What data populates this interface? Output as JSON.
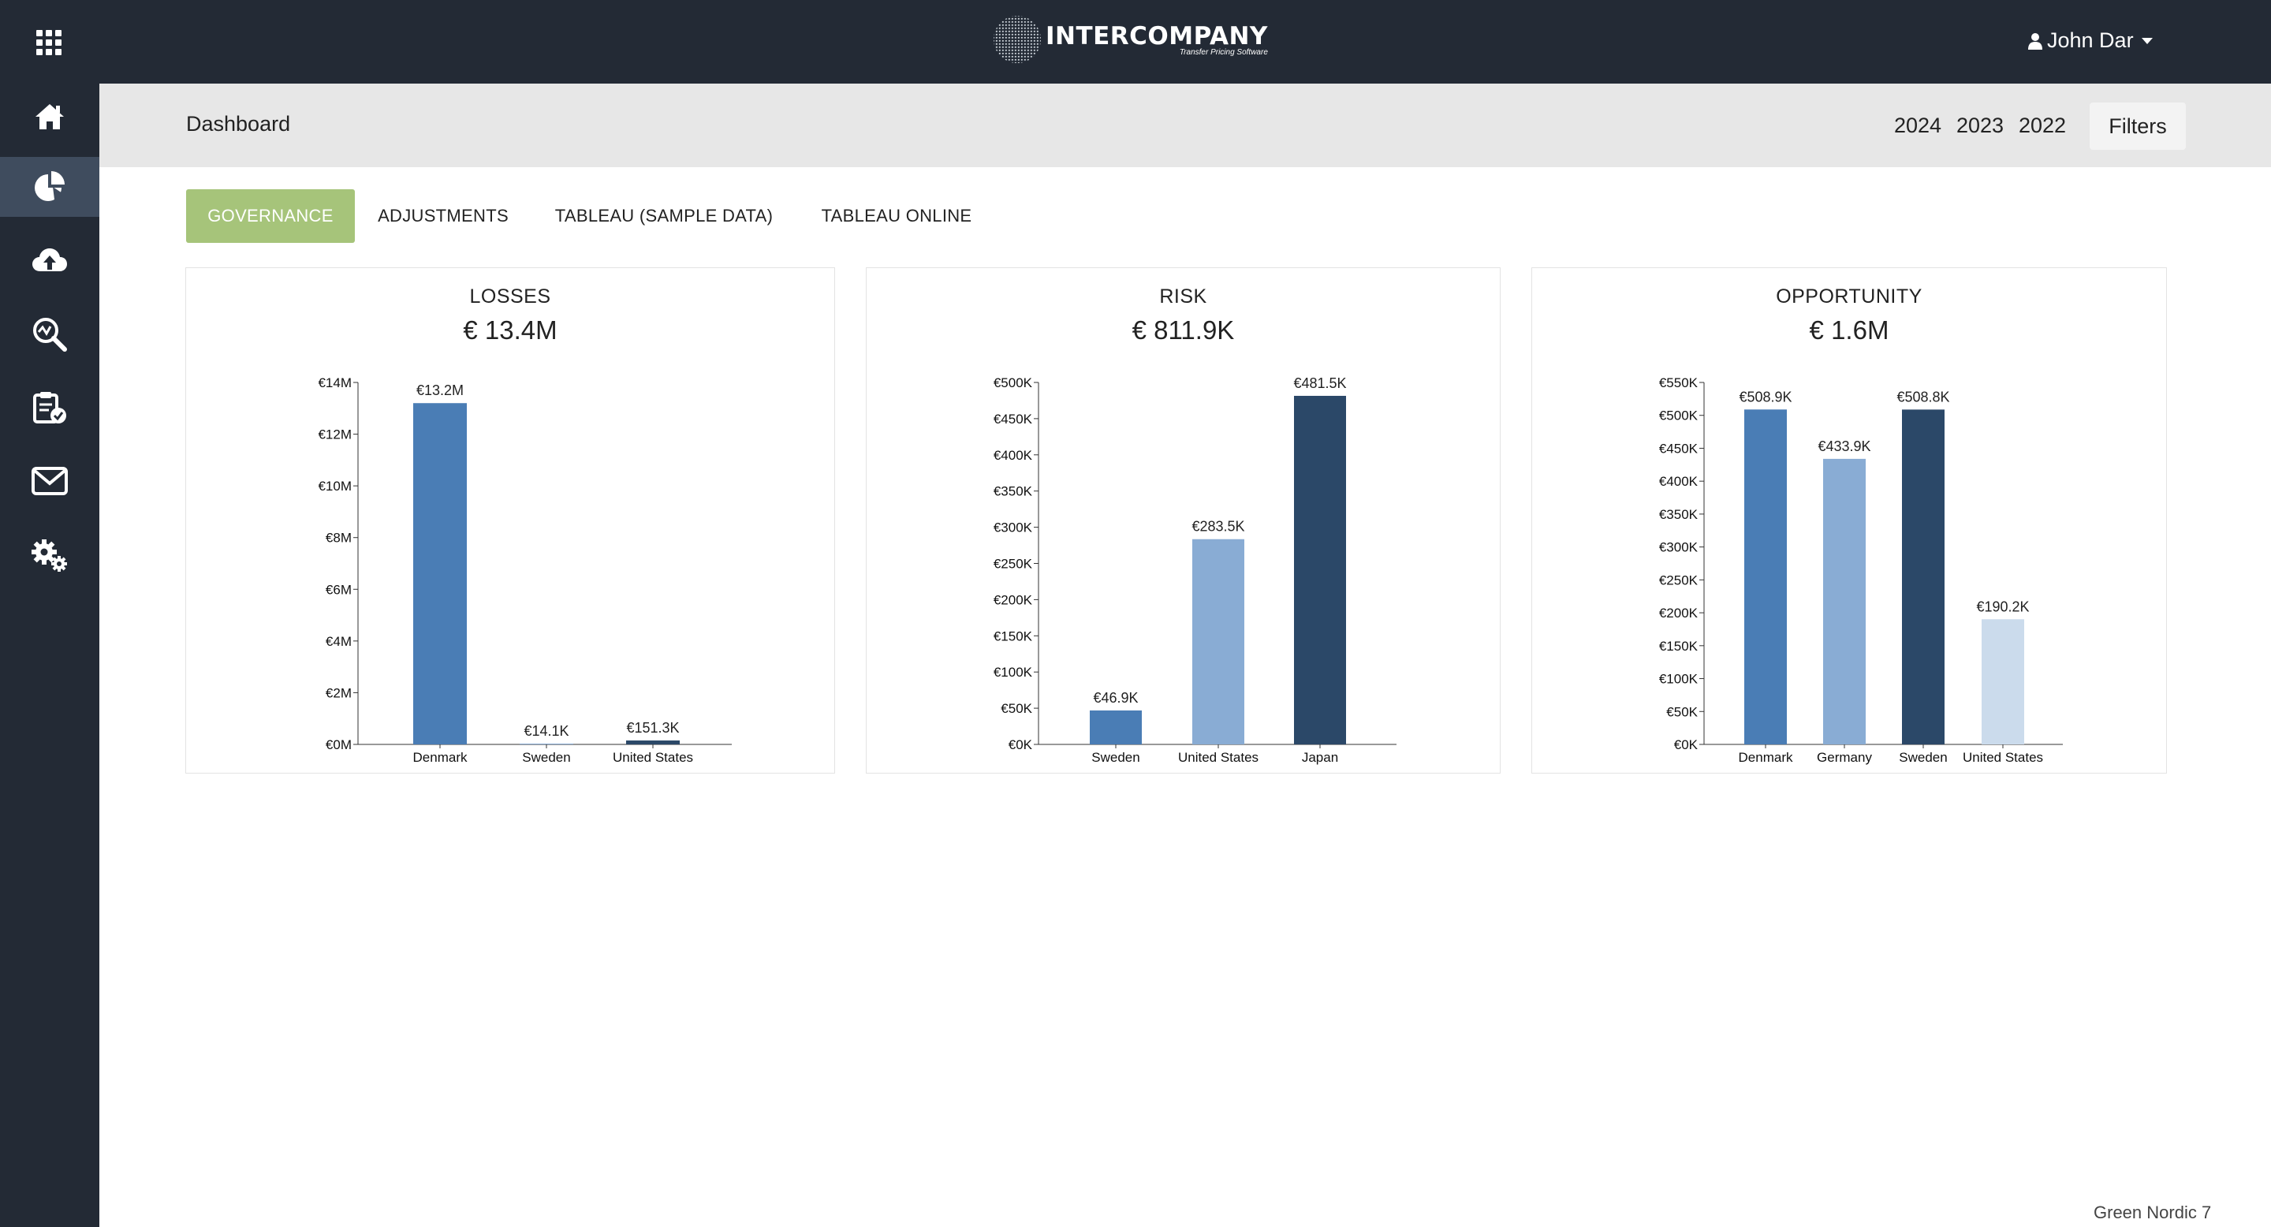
{
  "app": {
    "logo_name": "INTERCOMPANY",
    "logo_tagline": "Transfer Pricing Software"
  },
  "user": {
    "name": "John Dar"
  },
  "sidebar": {
    "items": [
      {
        "icon": "home-icon"
      },
      {
        "icon": "pie-chart-icon",
        "active": true
      },
      {
        "icon": "cloud-upload-icon"
      },
      {
        "icon": "analytics-search-icon"
      },
      {
        "icon": "clipboard-check-icon"
      },
      {
        "icon": "mail-icon"
      },
      {
        "icon": "settings-gears-icon"
      }
    ]
  },
  "header": {
    "title": "Dashboard",
    "years": [
      "2024",
      "2023",
      "2022"
    ],
    "filters_label": "Filters"
  },
  "tabs": [
    {
      "label": "GOVERNANCE",
      "active": true
    },
    {
      "label": "ADJUSTMENTS"
    },
    {
      "label": "TABLEAU (SAMPLE DATA)"
    },
    {
      "label": "TABLEAU ONLINE"
    }
  ],
  "cards": [
    {
      "title": "LOSSES",
      "total": "€ 13.4M"
    },
    {
      "title": "RISK",
      "total": "€ 811.9K"
    },
    {
      "title": "OPPORTUNITY",
      "total": "€ 1.6M"
    }
  ],
  "chart_data": [
    {
      "type": "bar",
      "title": "LOSSES",
      "categories": [
        "Denmark",
        "Sweden",
        "United States"
      ],
      "values": [
        13200000,
        14100,
        151300
      ],
      "value_labels": [
        "€13.2M",
        "€14.1K",
        "€151.3K"
      ],
      "bar_colors": [
        "#4a7db5",
        "#89acd4",
        "#2b4868"
      ],
      "ylim": [
        0,
        14000000
      ],
      "y_ticks": [
        0,
        2000000,
        4000000,
        6000000,
        8000000,
        10000000,
        12000000,
        14000000
      ],
      "y_tick_labels": [
        "€0M",
        "€2M",
        "€4M",
        "€6M",
        "€8M",
        "€10M",
        "€12M",
        "€14M"
      ],
      "grid": false
    },
    {
      "type": "bar",
      "title": "RISK",
      "categories": [
        "Sweden",
        "United States",
        "Japan"
      ],
      "values": [
        46900,
        283500,
        481500
      ],
      "value_labels": [
        "€46.9K",
        "€283.5K",
        "€481.5K"
      ],
      "bar_colors": [
        "#4a7db5",
        "#89acd4",
        "#2b4868"
      ],
      "ylim": [
        0,
        500000
      ],
      "y_ticks": [
        0,
        50000,
        100000,
        150000,
        200000,
        250000,
        300000,
        350000,
        400000,
        450000,
        500000
      ],
      "y_tick_labels": [
        "€0K",
        "€50K",
        "€100K",
        "€150K",
        "€200K",
        "€250K",
        "€300K",
        "€350K",
        "€400K",
        "€450K",
        "€500K"
      ],
      "grid": false
    },
    {
      "type": "bar",
      "title": "OPPORTUNITY",
      "categories": [
        "Denmark",
        "Germany",
        "Sweden",
        "United States"
      ],
      "values": [
        508900,
        433900,
        508800,
        190200
      ],
      "value_labels": [
        "€508.9K",
        "€433.9K",
        "€508.8K",
        "€190.2K"
      ],
      "bar_colors": [
        "#4a7db5",
        "#89acd4",
        "#2b4868",
        "#cbdbec"
      ],
      "ylim": [
        0,
        550000
      ],
      "y_ticks": [
        0,
        50000,
        100000,
        150000,
        200000,
        250000,
        300000,
        350000,
        400000,
        450000,
        500000,
        550000
      ],
      "y_tick_labels": [
        "€0K",
        "€50K",
        "€100K",
        "€150K",
        "€200K",
        "€250K",
        "€300K",
        "€350K",
        "€400K",
        "€450K",
        "€500K",
        "€550K"
      ],
      "grid": false
    }
  ],
  "footer": {
    "text": "Green Nordic 7"
  }
}
